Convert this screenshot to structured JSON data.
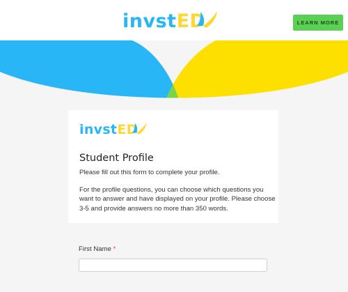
{
  "header": {
    "logo": {
      "part1": "invst",
      "part2": "ED"
    },
    "learn_more_label": "LEARN MORE"
  },
  "colors": {
    "brand_blue": "#29b6f6",
    "brand_yellow": "#fdd835",
    "brand_green": "#5ccf55",
    "required_red": "#e53935"
  },
  "card": {
    "logo": {
      "part1": "invst",
      "part2": "ED"
    },
    "title": "Student Profile",
    "subtitle": "Please fill out this form to complete your profile.",
    "body": "For the profile questions, you can choose which questions you want to answer and have displayed on your profile. Please choose 3-5 and provide answers no more than 350 words."
  },
  "form": {
    "first_name": {
      "label": "First Name",
      "required_mark": "*",
      "value": ""
    }
  }
}
